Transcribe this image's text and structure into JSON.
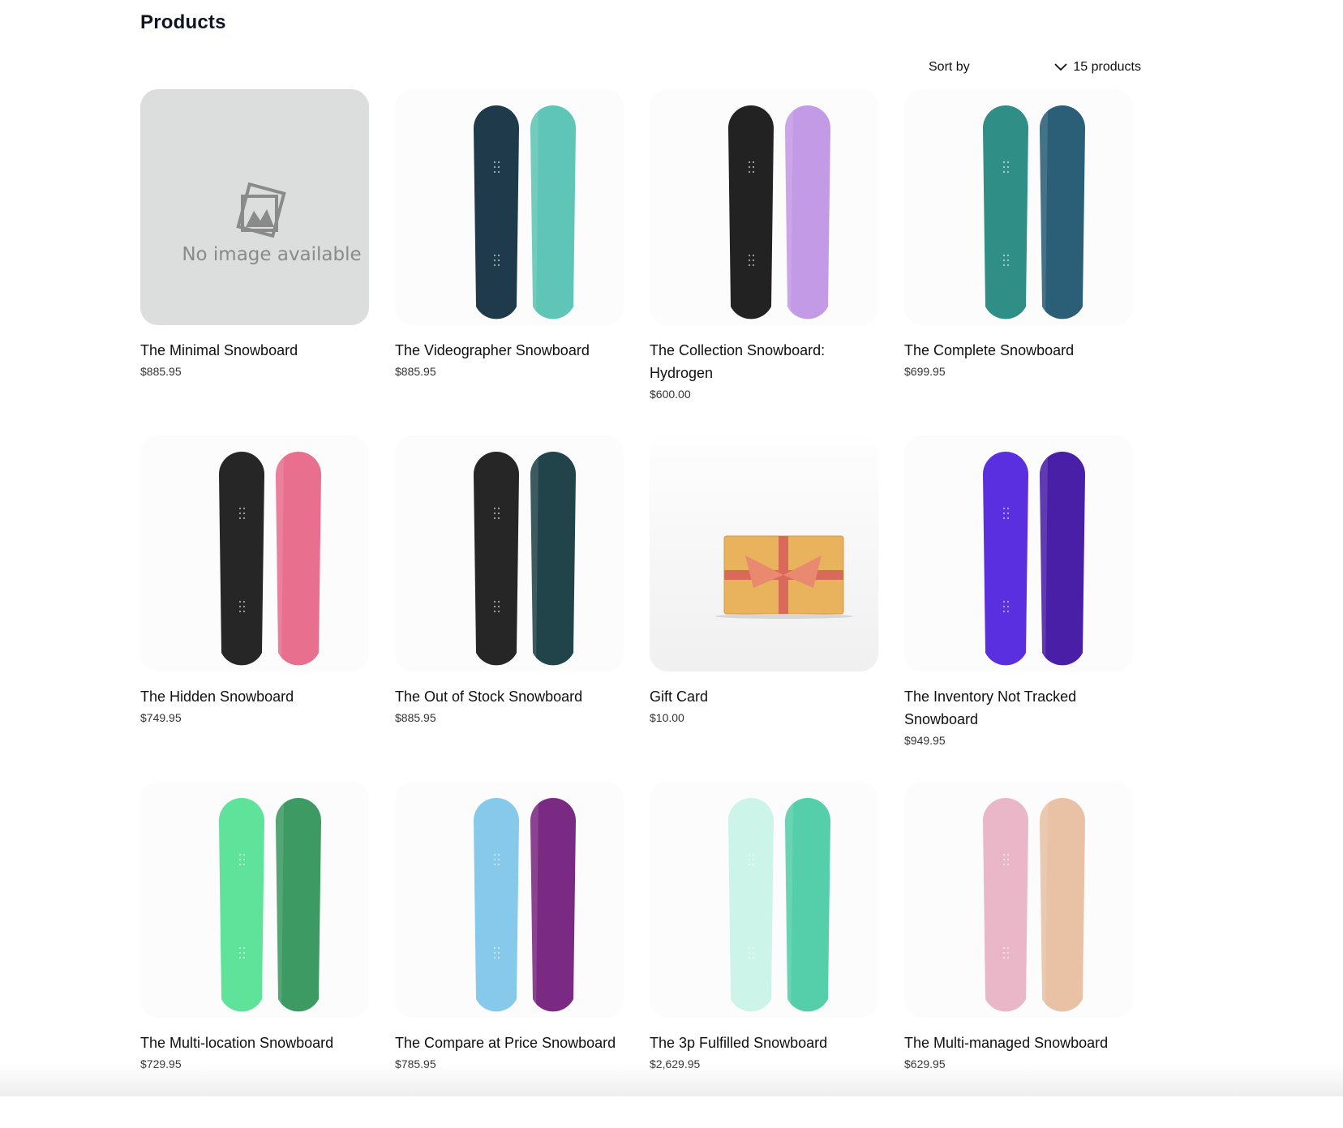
{
  "page": {
    "title": "Products"
  },
  "toolbar": {
    "sort_label": "Sort by",
    "count_label": "15 products",
    "chevron_icon": "chevron-down-icon"
  },
  "placeholder": {
    "text": "No image available",
    "icon": "image-placeholder-icon"
  },
  "products": [
    {
      "name": "The Minimal Snowboard",
      "price": "$885.95",
      "image": "placeholder"
    },
    {
      "name": "The Videographer Snowboard",
      "price": "$885.95",
      "image": "snowboard-pair",
      "colors": [
        "#1f3a4a",
        "#5fc5b6"
      ]
    },
    {
      "name": "The Collection Snowboard: Hydrogen",
      "price": "$600.00",
      "image": "snowboard-pair",
      "colors": [
        "#222222",
        "#c39ae6"
      ]
    },
    {
      "name": "The Complete Snowboard",
      "price": "$699.95",
      "image": "snowboard-pair",
      "colors": [
        "#2f8f86",
        "#2b5f78"
      ]
    },
    {
      "name": "The Hidden Snowboard",
      "price": "$749.95",
      "image": "snowboard-pair",
      "colors": [
        "#262626",
        "#e96f8f"
      ]
    },
    {
      "name": "The Out of Stock Snowboard",
      "price": "$885.95",
      "image": "snowboard-pair",
      "colors": [
        "#262626",
        "#21444a"
      ]
    },
    {
      "name": "Gift Card",
      "price": "$10.00",
      "image": "gift-card"
    },
    {
      "name": "The Inventory Not Tracked Snowboard",
      "price": "$949.95",
      "image": "snowboard-pair",
      "colors": [
        "#5a2fe0",
        "#4a1fa8"
      ]
    },
    {
      "name": "The Multi-location Snowboard",
      "price": "$729.95",
      "image": "snowboard-pair",
      "colors": [
        "#5fe39a",
        "#3d9a62"
      ]
    },
    {
      "name": "The Compare at Price Snowboard",
      "price": "$785.95",
      "image": "snowboard-pair",
      "colors": [
        "#86c9ea",
        "#7a2a82"
      ]
    },
    {
      "name": "The 3p Fulfilled Snowboard",
      "price": "$2,629.95",
      "image": "snowboard-pair",
      "colors": [
        "#cdf4e8",
        "#55cfa9"
      ]
    },
    {
      "name": "The Multi-managed Snowboard",
      "price": "$629.95",
      "image": "snowboard-pair",
      "colors": [
        "#e9b7c7",
        "#e9c2a6"
      ]
    }
  ]
}
